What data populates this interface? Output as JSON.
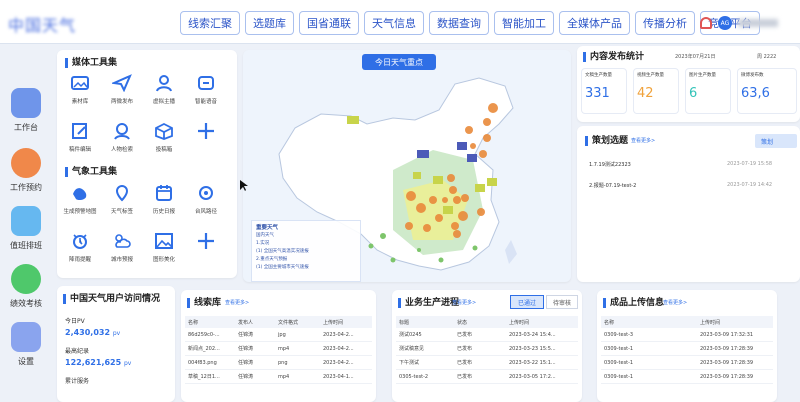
{
  "header": {
    "app_title": "中国天气",
    "nav": [
      "线索汇聚",
      "选题库",
      "国省通联",
      "天气信息",
      "数据查询",
      "智能加工",
      "全媒体产品",
      "传播分析",
      "竞赛平台"
    ],
    "avatar": "AG"
  },
  "sidebar": {
    "items": [
      {
        "label": "工作台",
        "icon": "workbench-icon",
        "color": "#6f95ea"
      },
      {
        "label": "工作预约",
        "icon": "calendar-icon",
        "color": "#f0884a"
      },
      {
        "label": "值班排班",
        "icon": "schedule-icon",
        "color": "#66b8f0"
      },
      {
        "label": "绩效考核",
        "icon": "chart-icon",
        "color": "#4fc86b"
      },
      {
        "label": "设置",
        "icon": "settings-icon",
        "color": "#8aa4ee"
      }
    ]
  },
  "media_tools": {
    "title": "媒体工具集",
    "items": [
      {
        "label": "素材库",
        "icon": "gallery-icon"
      },
      {
        "label": "两微发布",
        "icon": "send-icon"
      },
      {
        "label": "虚拟主播",
        "icon": "user-icon"
      },
      {
        "label": "智能语音",
        "icon": "microphone-icon"
      },
      {
        "label": "稿件编辑",
        "icon": "edit-icon"
      },
      {
        "label": "人物检索",
        "icon": "person-search-icon"
      },
      {
        "label": "投稿箱",
        "icon": "box-icon"
      },
      {
        "label": "",
        "icon": "plus-icon"
      }
    ]
  },
  "weather_tools": {
    "title": "气象工具集",
    "items": [
      {
        "label": "生成预警地图",
        "icon": "map-icon"
      },
      {
        "label": "天气标签",
        "icon": "tag-icon"
      },
      {
        "label": "历史日报",
        "icon": "history-icon"
      },
      {
        "label": "台风路径",
        "icon": "typhoon-icon"
      },
      {
        "label": "降雨提醒",
        "icon": "alarm-icon"
      },
      {
        "label": "城市预报",
        "icon": "weather-icon"
      },
      {
        "label": "图形美化",
        "icon": "image-icon"
      },
      {
        "label": "",
        "icon": "plus-icon"
      }
    ]
  },
  "map": {
    "title": "今日天气重点",
    "legend_title": "重要天气",
    "legend_items": [
      "国内天气",
      "1.实况",
      "(1) 全国天气高温实况速报",
      "2.重点天气预报",
      "(1) 全国主要城市天气速报"
    ]
  },
  "publish_stats": {
    "title": "内容发布统计",
    "date": "2023年07月21日",
    "extra": "周 2222",
    "cards": [
      {
        "label": "文稿生产数量",
        "value": "331",
        "color": "#2f6fe6"
      },
      {
        "label": "视频生产数量",
        "value": "42",
        "color": "#f0a23b"
      },
      {
        "label": "图片生产数量",
        "value": "6",
        "color": "#33c3b8"
      },
      {
        "label": "微博发布数",
        "value": "63,6",
        "color": "#2f6fe6"
      }
    ]
  },
  "topics": {
    "title": "策划选题",
    "more": "查看更多>",
    "button": "策划",
    "items": [
      {
        "name": "1.7.19测试22323",
        "time": "2023-07-19 15:58"
      },
      {
        "name": "2.报题-07.19-test-2",
        "time": "2023-07-19 14:42"
      }
    ]
  },
  "visits": {
    "title": "中国天气用户访问情况",
    "rows": [
      {
        "label": "今日PV",
        "value": "2,430,032",
        "unit": "pv"
      },
      {
        "label": "最高纪录",
        "value": "122,621,625",
        "unit": "pv"
      },
      {
        "label": "累计服务",
        "value": "",
        "unit": ""
      }
    ]
  },
  "clues": {
    "title": "线索库",
    "more": "查看更多>",
    "columns": [
      "名称",
      "发布人",
      "文件格式",
      "上传时间"
    ],
    "rows": [
      [
        "86d259c0-...",
        "任锦涛",
        "jpg",
        "2023-04-2..."
      ],
      [
        "新闻点_202...",
        "任锦涛",
        "mp4",
        "2023-04-2..."
      ],
      [
        "004f83.png",
        "任锦涛",
        "png",
        "2023-04-2..."
      ],
      [
        "草稿_12日1...",
        "任锦涛",
        "mp4",
        "2023-04-1..."
      ]
    ]
  },
  "production": {
    "title": "业务生产进程",
    "more": "查看更多>",
    "tabs": [
      "已通过",
      "待审核"
    ],
    "columns": [
      "标题",
      "状态",
      "上传时间"
    ],
    "rows": [
      [
        "测试0245",
        "已发布",
        "2023-03-24 15:4..."
      ],
      [
        "测试稿意见",
        "已发布",
        "2023-03-23 15:5..."
      ],
      [
        "下午测试",
        "已发布",
        "2023-03-22 15:1..."
      ],
      [
        "0305-test-2",
        "已发布",
        "2023-03-05 17:2..."
      ]
    ]
  },
  "uploads": {
    "title": "成品上传信息",
    "more": "查看更多>",
    "columns": [
      "名称",
      "上传时间"
    ],
    "rows": [
      [
        "0309-test-3",
        "2023-03-09 17:32:31"
      ],
      [
        "0309-test-1",
        "2023-03-09 17:28:39"
      ],
      [
        "0309-test-1",
        "2023-03-09 17:28:39"
      ],
      [
        "0309-test-1",
        "2023-03-09 17:28:39"
      ]
    ]
  }
}
